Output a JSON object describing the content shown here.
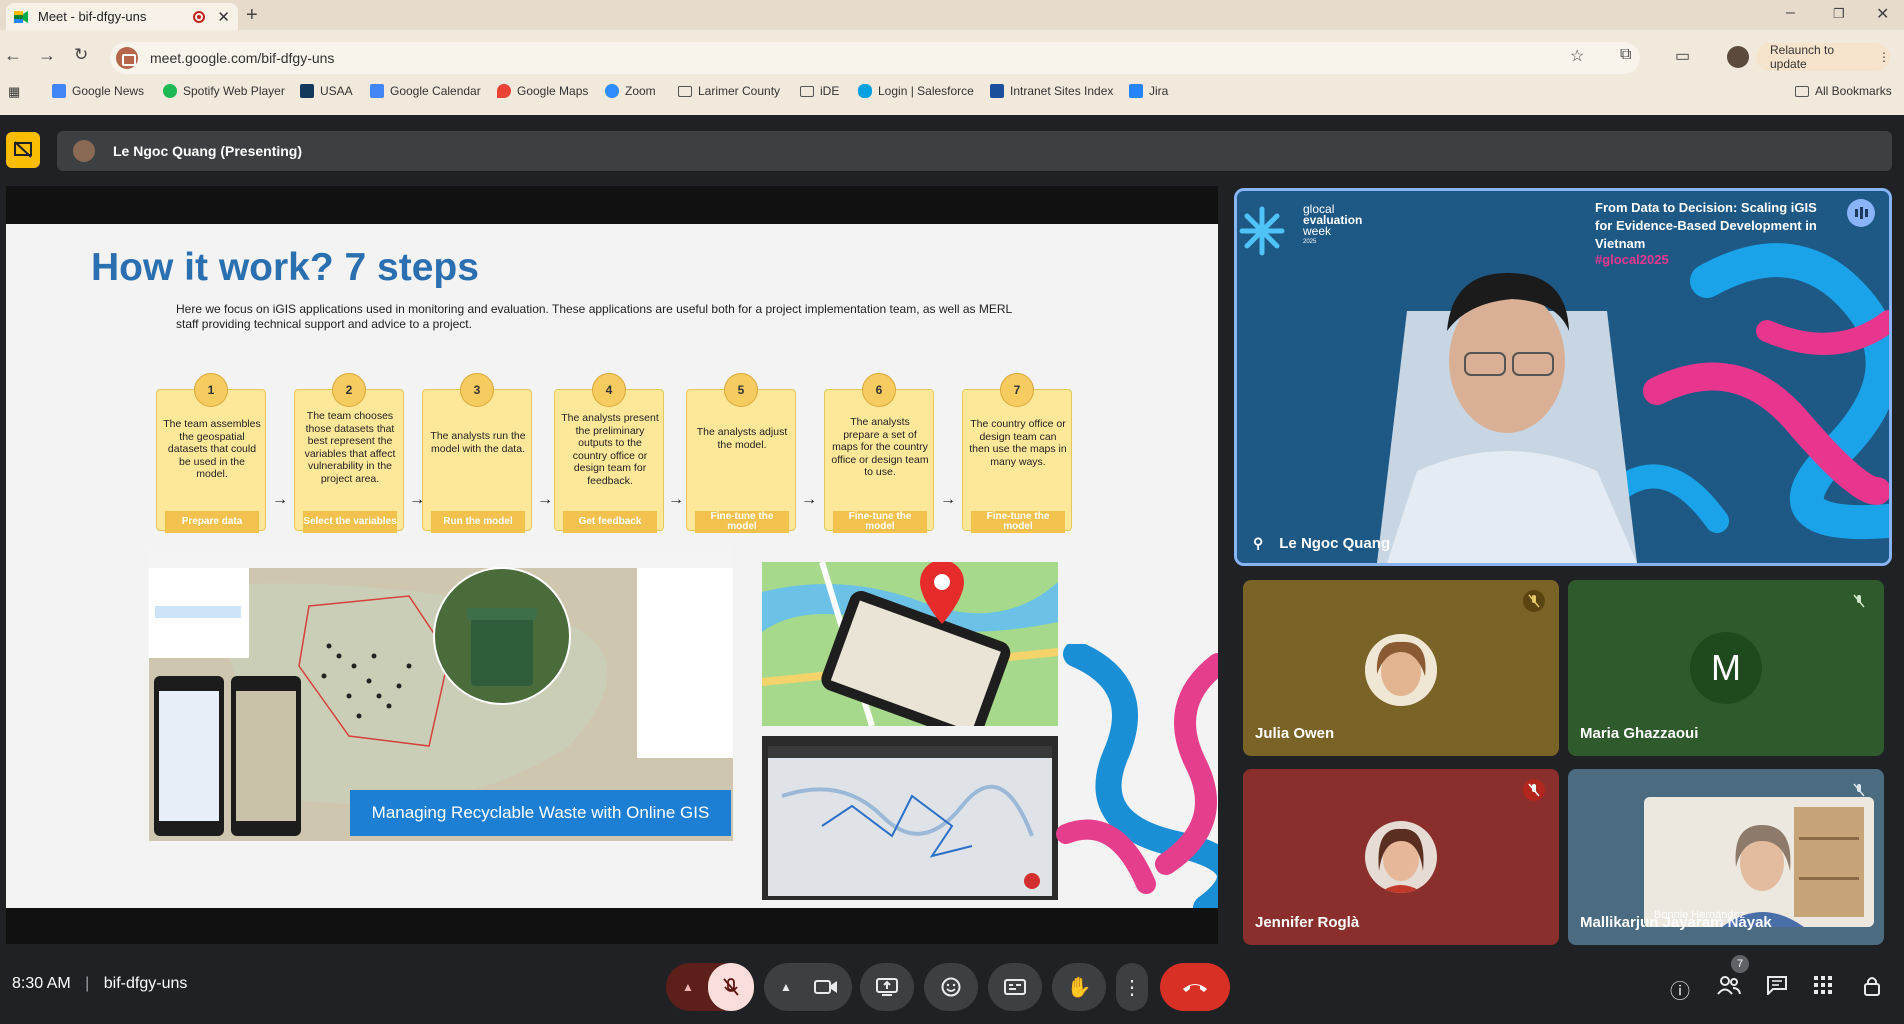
{
  "browser": {
    "tab_title": "Meet - bif-dfgy-uns",
    "url": "meet.google.com/bif-dfgy-uns",
    "relaunch_label": "Relaunch to update",
    "all_bookmarks_label": "All Bookmarks",
    "bookmarks": [
      "Google News",
      "Spotify Web Player",
      "USAA",
      "Google Calendar",
      "Google Maps",
      "Zoom",
      "Larimer County",
      "iDE",
      "Login | Salesforce",
      "Intranet Sites Index",
      "Jira"
    ]
  },
  "presenting": {
    "label": "Le Ngoc Quang (Presenting)"
  },
  "slide": {
    "title": "How it work? 7 steps",
    "description": "Here we focus on iGIS applications used in monitoring and evaluation. These applications are useful both for a project implementation team, as well as MERL staff providing technical support and advice to a project.",
    "steps": [
      {
        "num": "1",
        "desc": "The team assembles the geospatial datasets that could be used in the model.",
        "label": "Prepare data"
      },
      {
        "num": "2",
        "desc": "The team chooses those datasets that best represent the variables that affect vulnerability in the project area.",
        "label": "Select the variables"
      },
      {
        "num": "3",
        "desc": "The analysts run the model with the data.",
        "label": "Run the model"
      },
      {
        "num": "4",
        "desc": "The analysts present the preliminary outputs to the country office or design team for feedback.",
        "label": "Get feedback"
      },
      {
        "num": "5",
        "desc": "The analysts adjust the model.",
        "label": "Fine-tune the model"
      },
      {
        "num": "6",
        "desc": "The analysts prepare a set of maps for the country office or design team to use.",
        "label": "Fine-tune the model"
      },
      {
        "num": "7",
        "desc": "The country office or design team can then use the maps in many ways.",
        "label": "Fine-tune the model"
      }
    ],
    "banner": "Managing Recyclable Waste with Online GIS"
  },
  "spotlight": {
    "logo_line1": "glocal",
    "logo_line2": "evaluation",
    "logo_line3": "week",
    "logo_year": "2025",
    "headline": "From Data to Decision: Scaling iGIS for Evidence-Based Development in Vietnam",
    "hashtag": "#glocal2025",
    "name": "Le Ngoc Quang"
  },
  "participants": [
    {
      "name": "Julia Owen",
      "bg": "#7a6326"
    },
    {
      "name": "Maria Ghazzaoui",
      "initial": "M",
      "bg": "#2e5a2c"
    },
    {
      "name": "Jennifer Roglà",
      "bg": "#8a2f2b"
    },
    {
      "name": "Mallikarjun Jayaram Nayak",
      "overlay_name": "Bonnie Hernández",
      "bg": "#4a6b80"
    }
  ],
  "bottom": {
    "time": "8:30 AM",
    "meeting_code": "bif-dfgy-uns",
    "participant_count": "7"
  },
  "colors": {
    "end_call": "#d93025",
    "accent_blue": "#8ab4f8",
    "present_yellow": "#fbbc04"
  }
}
